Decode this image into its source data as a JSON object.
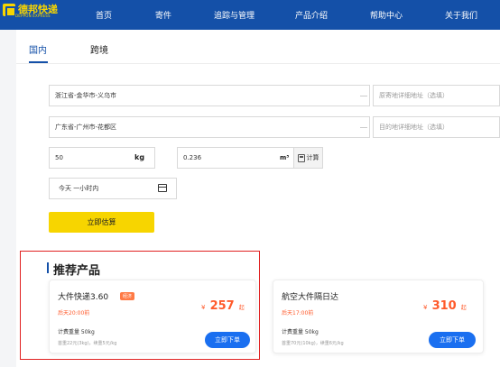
{
  "header": {
    "logo_text": "德邦快递",
    "logo_sub": "DEPPON EXPRESS",
    "nav": [
      "首页",
      "寄件",
      "追踪与管理",
      "产品介绍",
      "帮助中心",
      "关于我们"
    ]
  },
  "tabs": [
    "国内",
    "跨境"
  ],
  "form": {
    "origin": "浙江省-金华市-义乌市",
    "origin_detail_placeholder": "原寄地详细地址（选填）",
    "destination": "广东省-广州市-花都区",
    "destination_detail_placeholder": "目的地详细地址（选填）",
    "weight": "50",
    "weight_unit": "kg",
    "volume": "0.236",
    "volume_unit": "m³",
    "calc_label": "计算",
    "time": "今天  一小时内",
    "estimate_label": "立即估算"
  },
  "recommend": {
    "title": "推荐产品",
    "products": [
      {
        "name": "大件快递3.60",
        "badge": "经济",
        "deadline": "后天20:00前",
        "currency": "¥",
        "price": "257",
        "price_suffix": "起",
        "weight_text": "计费重量 50kg",
        "detail_text": "首重22元(3kg)，续重5元/kg",
        "order_label": "立即下单"
      },
      {
        "name": "航空大件隔日达",
        "deadline": "后天17:00前",
        "currency": "¥",
        "price": "310",
        "price_suffix": "起",
        "weight_text": "计费重量 50kg",
        "detail_text": "首重70元(10kg)，续重6元/kg",
        "order_label": "立即下单"
      }
    ]
  },
  "colors": {
    "nav_bg": "#1450a8",
    "brand_yellow": "#f7d500",
    "price_orange": "#ff5a2b",
    "order_blue": "#1a6ff0",
    "highlight_red": "#e02020"
  }
}
